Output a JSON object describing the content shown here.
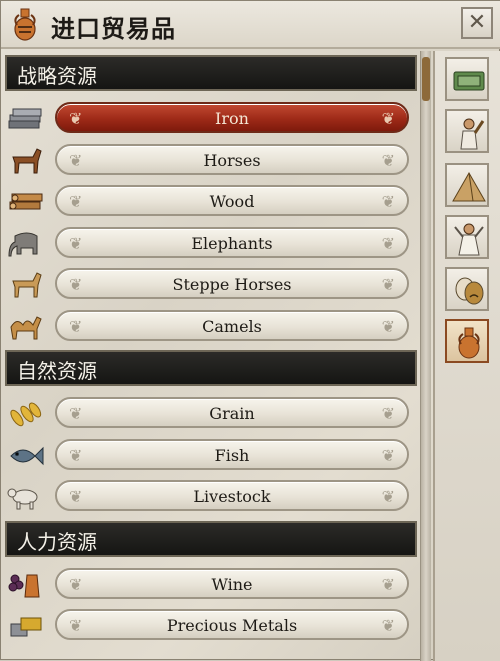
{
  "window": {
    "title": "进口贸易品",
    "close_label": "✕"
  },
  "sections": [
    {
      "header": "战略资源",
      "items": [
        {
          "label": "Iron",
          "icon": "iron-icon",
          "selected": true
        },
        {
          "label": "Horses",
          "icon": "horse-icon",
          "selected": false
        },
        {
          "label": "Wood",
          "icon": "wood-icon",
          "selected": false
        },
        {
          "label": "Elephants",
          "icon": "elephant-icon",
          "selected": false
        },
        {
          "label": "Steppe Horses",
          "icon": "steppe-horse-icon",
          "selected": false
        },
        {
          "label": "Camels",
          "icon": "camel-icon",
          "selected": false
        }
      ]
    },
    {
      "header": "自然资源",
      "items": [
        {
          "label": "Grain",
          "icon": "grain-icon",
          "selected": false
        },
        {
          "label": "Fish",
          "icon": "fish-icon",
          "selected": false
        },
        {
          "label": "Livestock",
          "icon": "livestock-icon",
          "selected": false
        }
      ]
    },
    {
      "header": "人力资源",
      "items": [
        {
          "label": "Wine",
          "icon": "wine-icon",
          "selected": false
        },
        {
          "label": "Precious Metals",
          "icon": "precious-metals-icon",
          "selected": false
        }
      ]
    }
  ],
  "sidebar_tabs": [
    {
      "icon": "banknote-icon",
      "active": false
    },
    {
      "icon": "worker-icon",
      "active": false
    },
    {
      "icon": "pyramid-icon",
      "active": false
    },
    {
      "icon": "priest-icon",
      "active": false
    },
    {
      "icon": "theater-masks-icon",
      "active": false
    },
    {
      "icon": "amphora-icon",
      "active": true
    }
  ],
  "colors": {
    "selected_red": "#9e2a18",
    "header_black": "#1b1b19",
    "accent_orange": "#c9732f"
  }
}
